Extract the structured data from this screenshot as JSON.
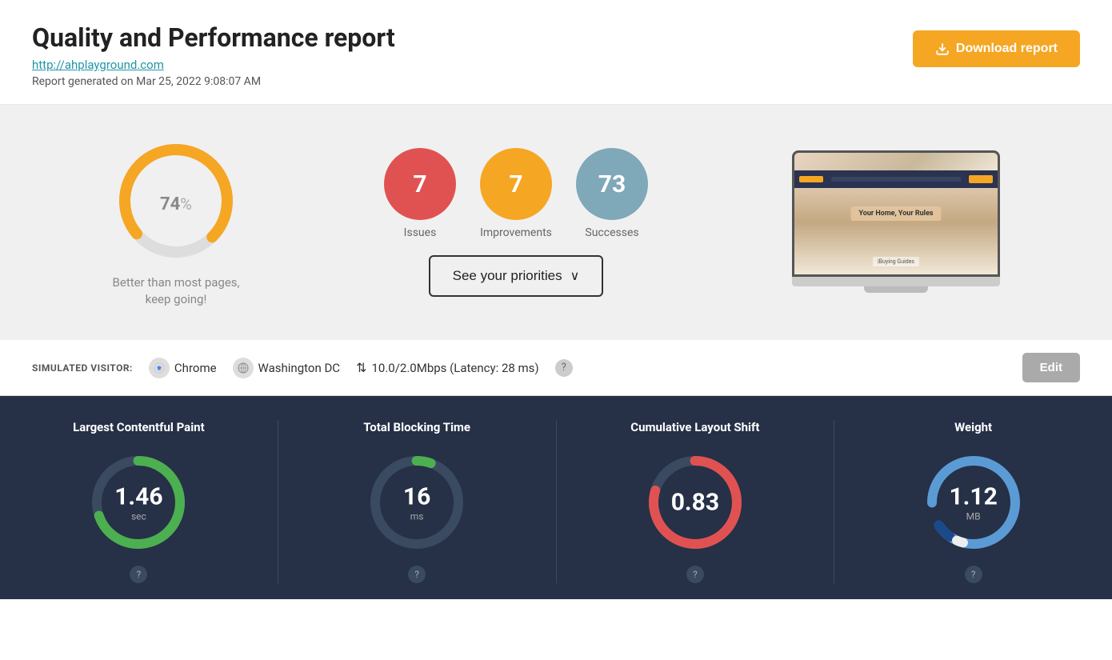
{
  "header": {
    "title": "Quality and Performance report",
    "url": "http://ahplayground.com",
    "report_date": "Report generated on Mar 25, 2022 9:08:07 AM",
    "download_btn": "Download report"
  },
  "summary": {
    "score_percent": "74",
    "score_symbol": "%",
    "score_label": "Better than most pages,\nkeep going!",
    "issues_count": "7",
    "issues_label": "Issues",
    "improvements_count": "7",
    "improvements_label": "Improvements",
    "successes_count": "73",
    "successes_label": "Successes",
    "priorities_btn": "See your priorities",
    "chevron": "∨"
  },
  "visitor": {
    "label": "SIMULATED VISITOR:",
    "browser": "Chrome",
    "location": "Washington DC",
    "speed": "10.0/2.0Mbps (Latency: 28 ms)",
    "edit_btn": "Edit"
  },
  "metrics": {
    "lcp": {
      "title": "Largest Contentful Paint",
      "value": "1.46",
      "unit": "sec"
    },
    "tbt": {
      "title": "Total Blocking Time",
      "value": "16",
      "unit": "ms"
    },
    "cls": {
      "title": "Cumulative Layout Shift",
      "value": "0.83",
      "unit": ""
    },
    "weight": {
      "title": "Weight",
      "value": "1.12",
      "unit": "MB"
    }
  }
}
